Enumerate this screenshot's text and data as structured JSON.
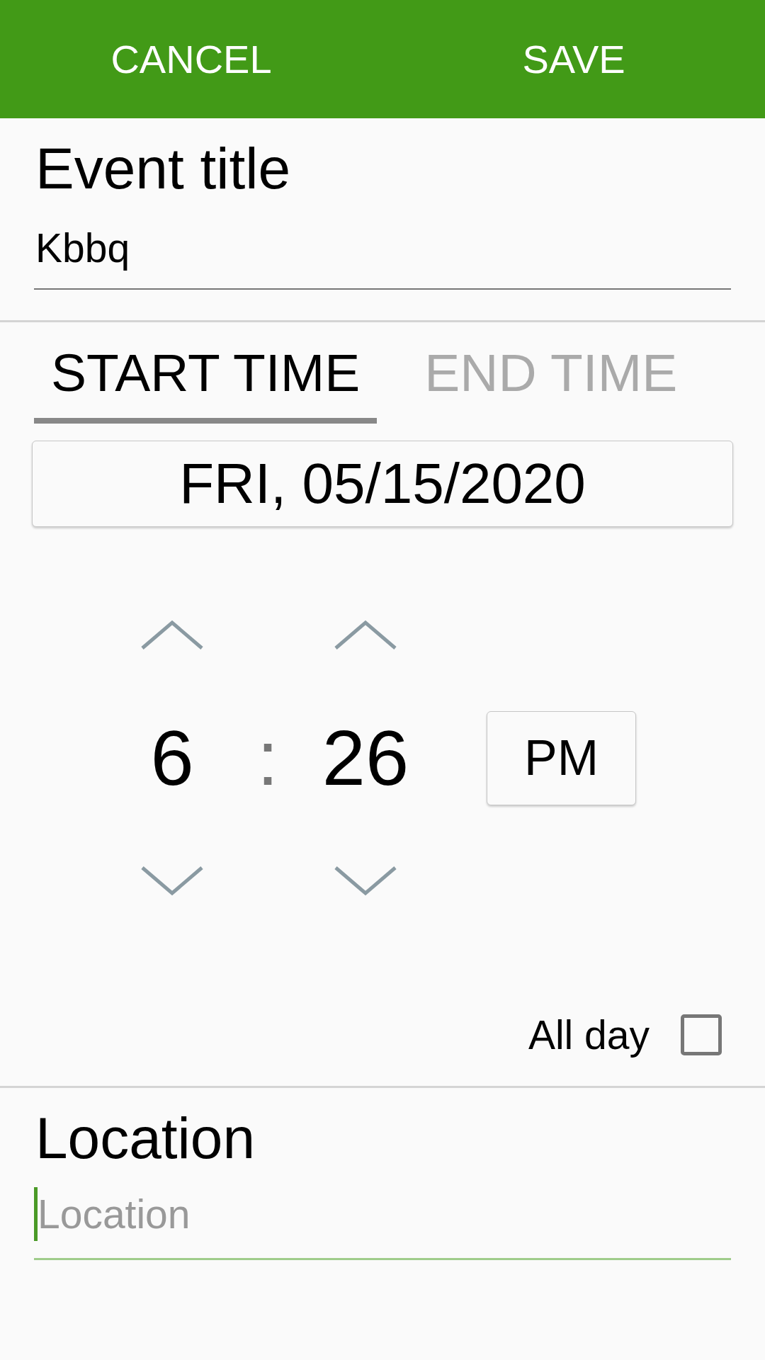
{
  "toolbar": {
    "buttons": [
      {
        "label": "CANCEL"
      },
      {
        "label": "SAVE"
      }
    ]
  },
  "event_title": {
    "label": "Event title",
    "value": "Kbbq"
  },
  "tabs": [
    {
      "label": "START TIME",
      "selected": true
    },
    {
      "label": "END TIME",
      "selected": false
    }
  ],
  "date": "FRI, 05/15/2020",
  "time": {
    "hour": "6",
    "separator": ":",
    "minute": "26",
    "meridiem": "PM"
  },
  "all_day": {
    "label": "All day",
    "checked": false
  },
  "location": {
    "label": "Location",
    "placeholder": "Location",
    "focused": true
  }
}
